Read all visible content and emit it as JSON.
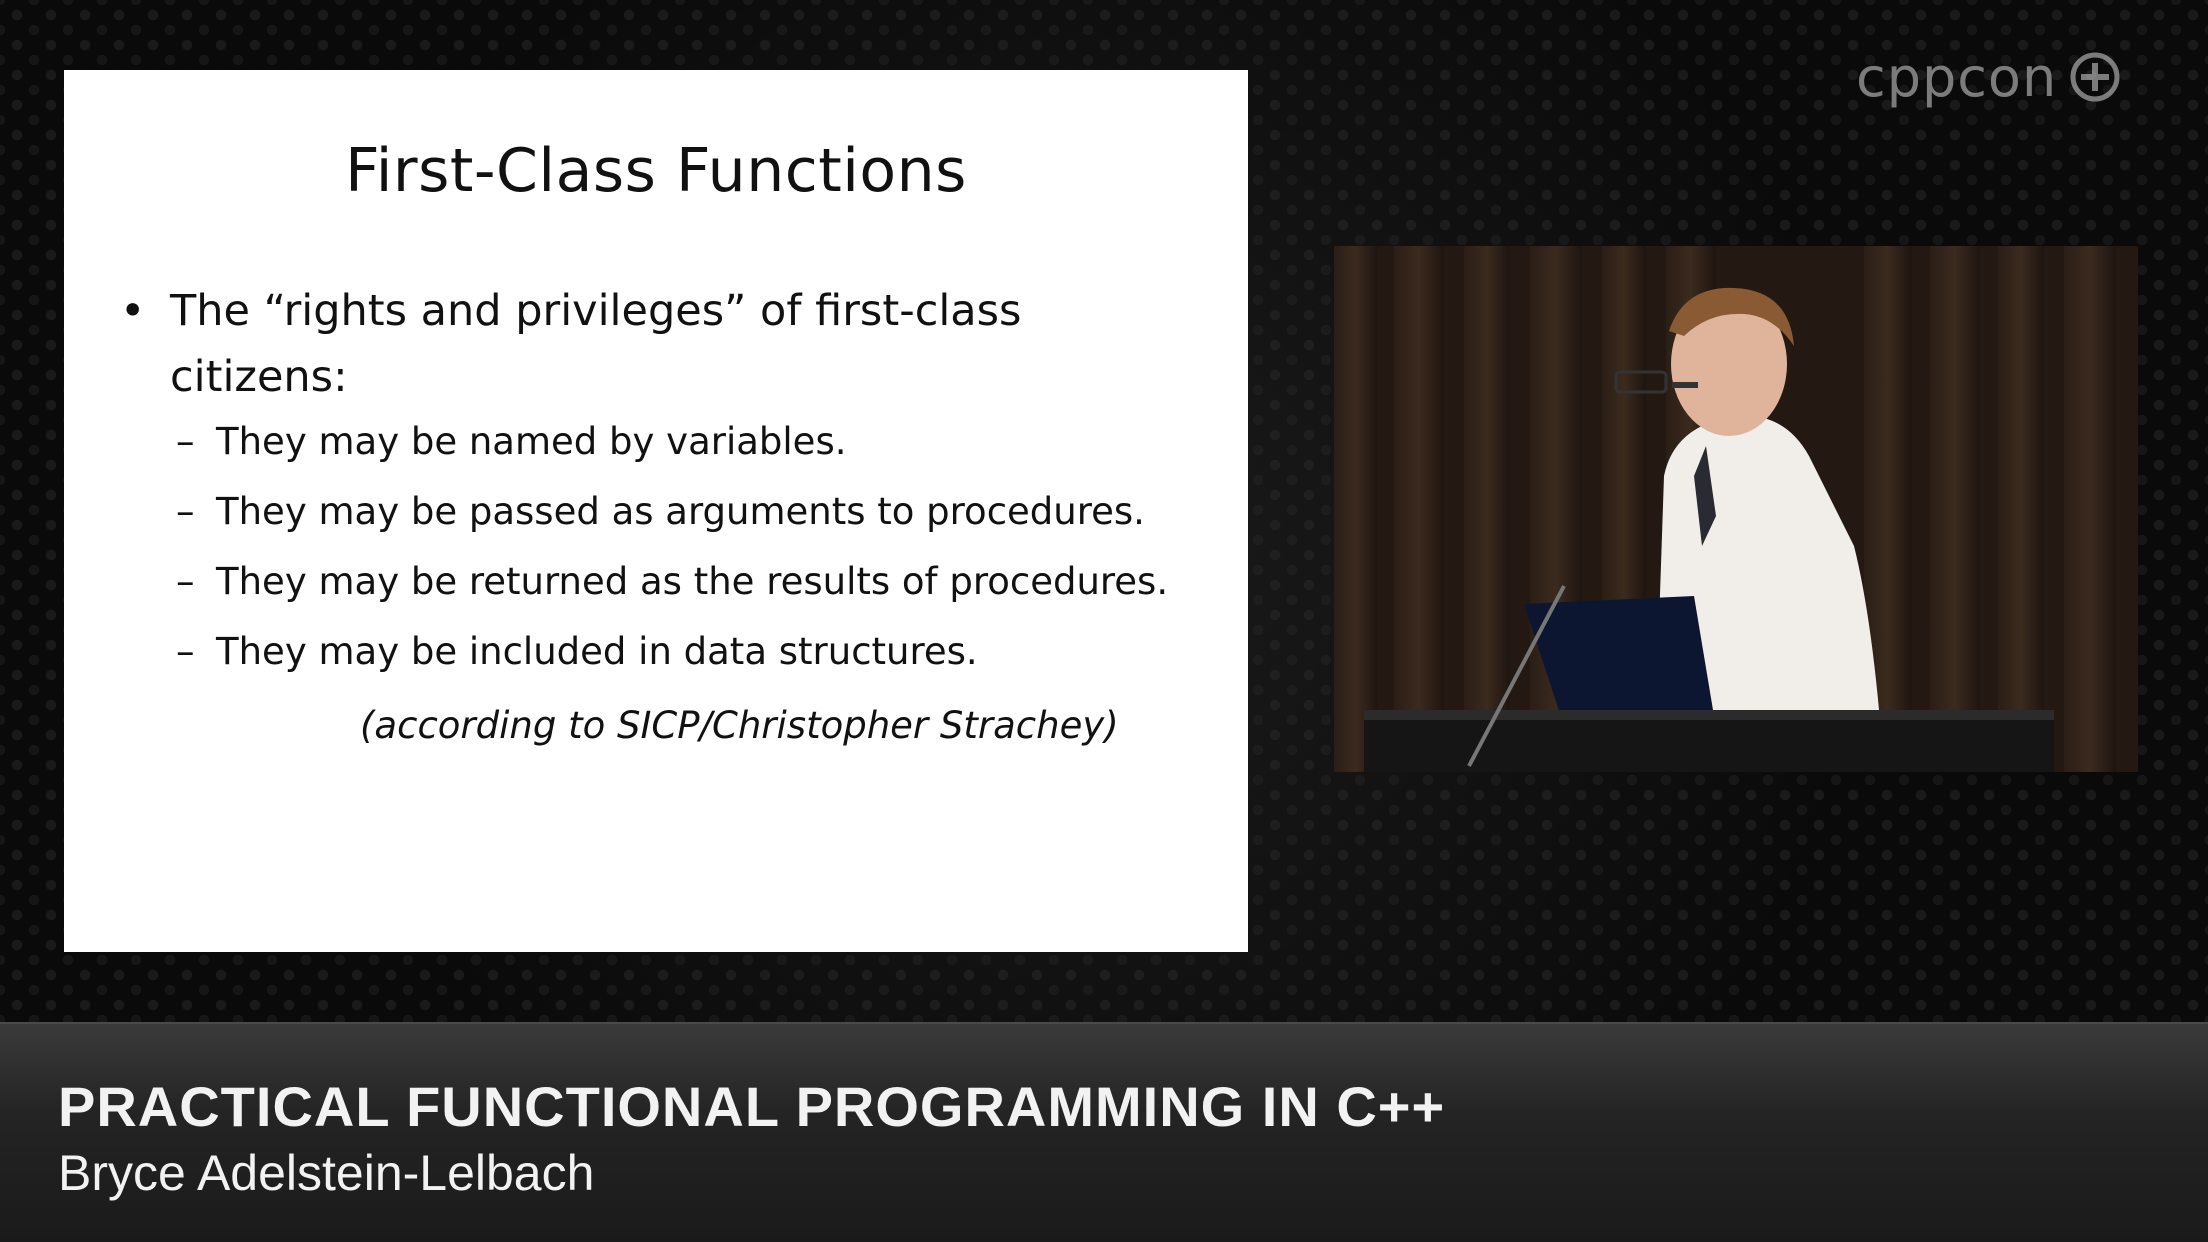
{
  "slide": {
    "title": "First-Class Functions",
    "bullet_symbol": "•",
    "bullet": "The “rights and privileges” of first-class citizens:",
    "sub_dash": "–",
    "sub_items": [
      "They may be named by variables.",
      "They may be passed as arguments to procedures.",
      "They may be returned as the results of procedures.",
      "They may be included in data structures."
    ],
    "citation": "(according to SICP/Christopher Strachey)"
  },
  "logo": {
    "text": "cppcon",
    "icon": "plus-circle-icon"
  },
  "video": {
    "icon": "speaker-video"
  },
  "lower_third": {
    "talk_title": "PRACTICAL FUNCTIONAL PROGRAMMING IN C++",
    "speaker": "Bryce Adelstein-Lelbach"
  }
}
